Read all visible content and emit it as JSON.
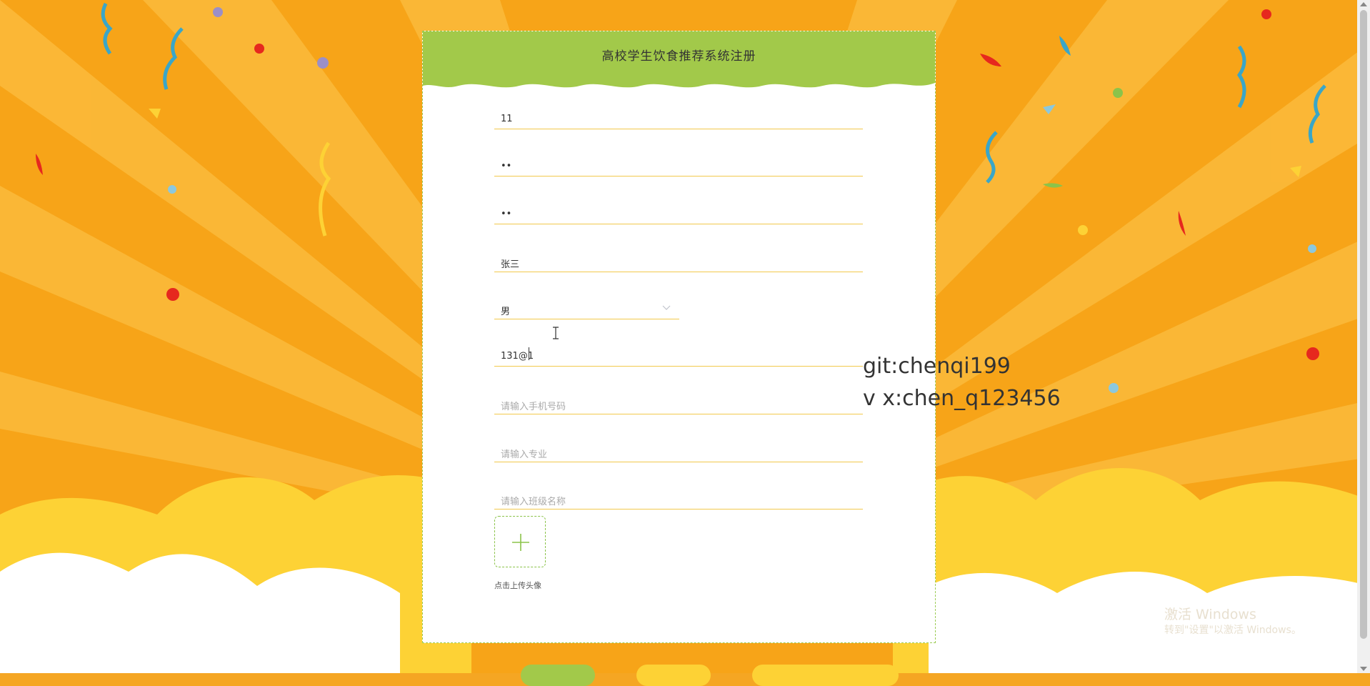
{
  "card": {
    "title": "高校学生饮食推荐系统注册"
  },
  "form": {
    "username": {
      "value": "11"
    },
    "password": {
      "value": "••"
    },
    "confirm_password": {
      "value": "••"
    },
    "real_name": {
      "value": "张三"
    },
    "gender": {
      "selected": "男"
    },
    "email": {
      "value": "131@1"
    },
    "phone": {
      "placeholder": "请输入手机号码"
    },
    "major": {
      "placeholder": "请输入专业"
    },
    "class_name": {
      "placeholder": "请输入班级名称"
    },
    "avatar": {
      "label": "点击上传头像"
    }
  },
  "watermark": {
    "line1": "git:chenqi199",
    "line2": "v x:chen_q123456"
  },
  "windows_activation": {
    "title": "激活 Windows",
    "subtitle": "转到\"设置\"以激活 Windows。"
  },
  "colors": {
    "header_green": "#a2c94a",
    "field_underline": "#f2c94c",
    "background_orange": "#f5a623"
  },
  "icons": [
    "plus-icon",
    "chevron-down-icon",
    "text-cursor-icon"
  ]
}
